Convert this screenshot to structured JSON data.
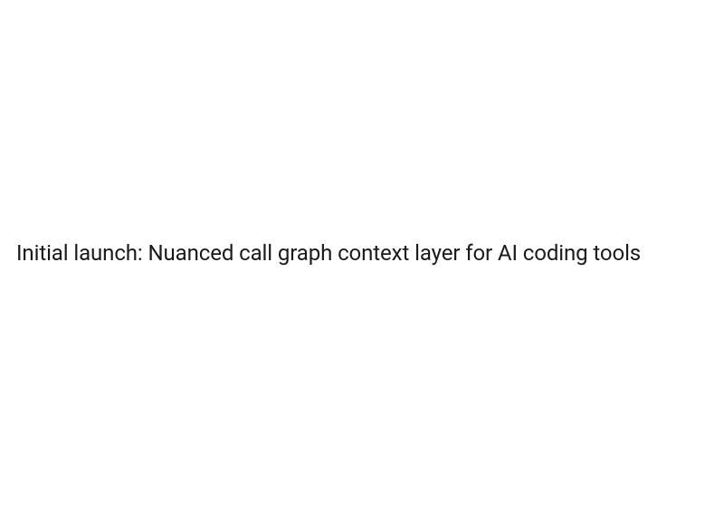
{
  "headline": "Initial launch: Nuanced call graph context layer for AI coding tools"
}
